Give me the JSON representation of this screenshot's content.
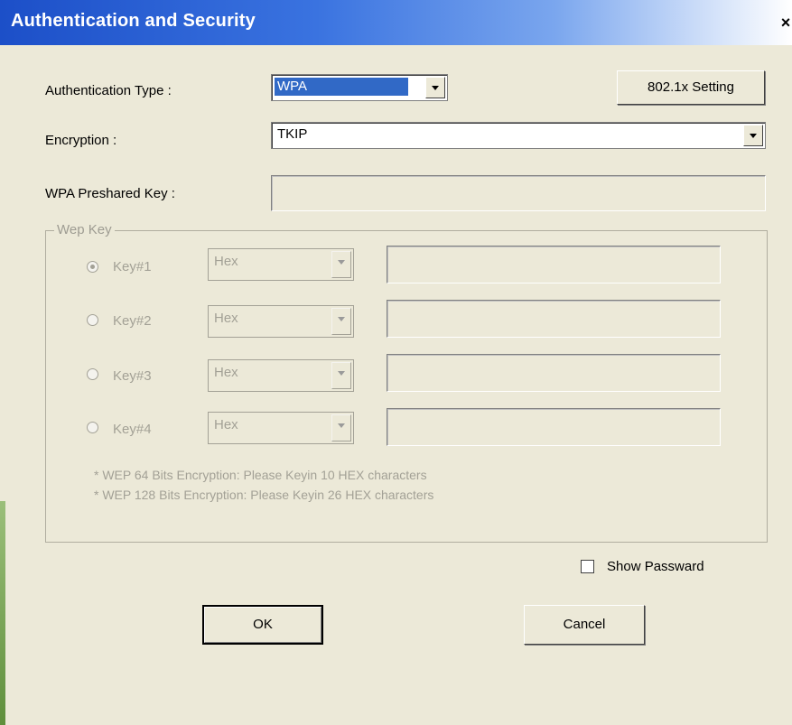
{
  "window": {
    "title": "Authentication and Security",
    "close_label": "×"
  },
  "auth_type": {
    "label": "Authentication Type :",
    "value": "WPA"
  },
  "setting_button": {
    "label": "802.1x Setting"
  },
  "encryption": {
    "label": "Encryption :",
    "value": "TKIP"
  },
  "preshared_key": {
    "label": "WPA Preshared Key :",
    "value": ""
  },
  "wep_key": {
    "group_label": "Wep Key",
    "keys": [
      {
        "label": "Key#1",
        "format": "Hex",
        "value": "",
        "selected": true
      },
      {
        "label": "Key#2",
        "format": "Hex",
        "value": "",
        "selected": false
      },
      {
        "label": "Key#3",
        "format": "Hex",
        "value": "",
        "selected": false
      },
      {
        "label": "Key#4",
        "format": "Hex",
        "value": "",
        "selected": false
      }
    ],
    "note_64": "* WEP 64 Bits Encryption:   Please Keyin 10 HEX characters",
    "note_128": "* WEP 128 Bits Encryption:   Please Keyin 26 HEX characters"
  },
  "show_password": {
    "label": "Show Passward",
    "checked": false
  },
  "buttons": {
    "ok": "OK",
    "cancel": "Cancel"
  }
}
